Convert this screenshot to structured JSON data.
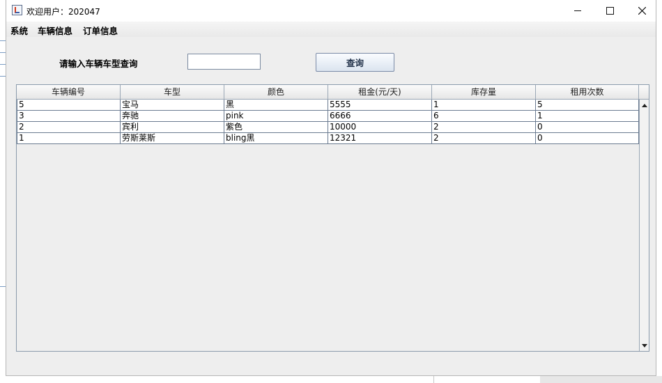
{
  "window": {
    "title": "欢迎用户：202047"
  },
  "menu": {
    "items": [
      "系统",
      "车辆信息",
      "订单信息"
    ]
  },
  "search": {
    "label": "请输入车辆车型查询",
    "value": "",
    "button_label": "查询"
  },
  "table": {
    "columns": [
      "车辆编号",
      "车型",
      "颜色",
      "租金(元/天)",
      "库存量",
      "租用次数"
    ],
    "rows": [
      [
        "5",
        "宝马",
        "黑",
        "5555",
        "1",
        "5"
      ],
      [
        "3",
        "奔驰",
        "pink",
        "6666",
        "6",
        "1"
      ],
      [
        "2",
        "宾利",
        "紫色",
        "10000",
        "2",
        "0"
      ],
      [
        "1",
        "劳斯莱斯",
        "bling黑",
        "12321",
        "2",
        "0"
      ]
    ]
  },
  "icons": {
    "app": "java-cup-icon",
    "minimize": "minimize-icon",
    "maximize": "maximize-icon",
    "close": "close-icon",
    "scroll_up": "arrow-up-icon",
    "scroll_down": "arrow-down-icon"
  }
}
